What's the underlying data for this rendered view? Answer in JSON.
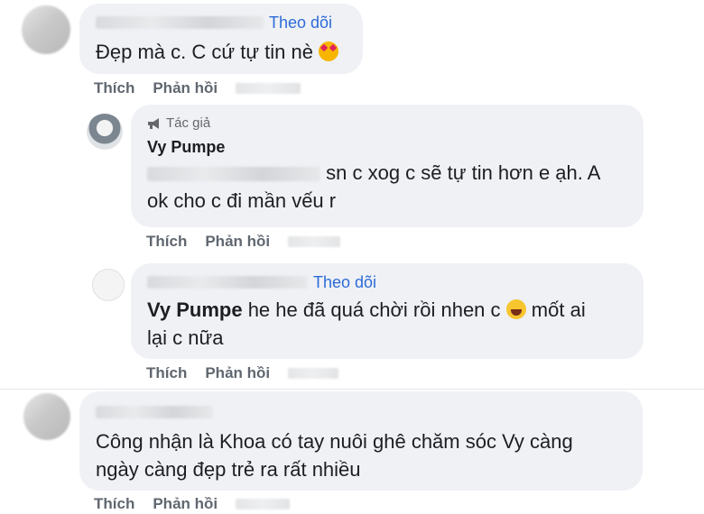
{
  "comments": [
    {
      "follow": "Theo dõi",
      "text": "Đẹp mà c. C cứ tự tin nè",
      "emoji": "smiling-face-with-hearts-emoji",
      "actions": {
        "like": "Thích",
        "reply": "Phản hồi"
      }
    },
    {
      "author_badge": "Tác giả",
      "author": "Vy Pumpe",
      "text_line1": "sn c xog c sẽ tự tin hơn e ạh. A",
      "text_line2": "ok cho c đi mần vếu r",
      "actions": {
        "like": "Thích",
        "reply": "Phản hồi"
      }
    },
    {
      "follow": "Theo dõi",
      "author": "Vy Pumpe",
      "text_line1_a": "he he đã quá chời rồi nhen c",
      "emoji": "laughing-face-emoji",
      "text_line1_b": "mốt ai",
      "text_line2": "lại c nữa",
      "actions": {
        "like": "Thích",
        "reply": "Phản hồi"
      }
    },
    {
      "text_line1": "Công nhận là Khoa có tay nuôi ghê chăm sóc Vy càng",
      "text_line2": "ngày càng đẹp trẻ ra rất nhiều",
      "actions": {
        "like": "Thích",
        "reply": "Phản hồi"
      }
    }
  ],
  "colors": {
    "bubble": "#eff1f5",
    "link": "#2d6bd8",
    "action": "#606770"
  }
}
